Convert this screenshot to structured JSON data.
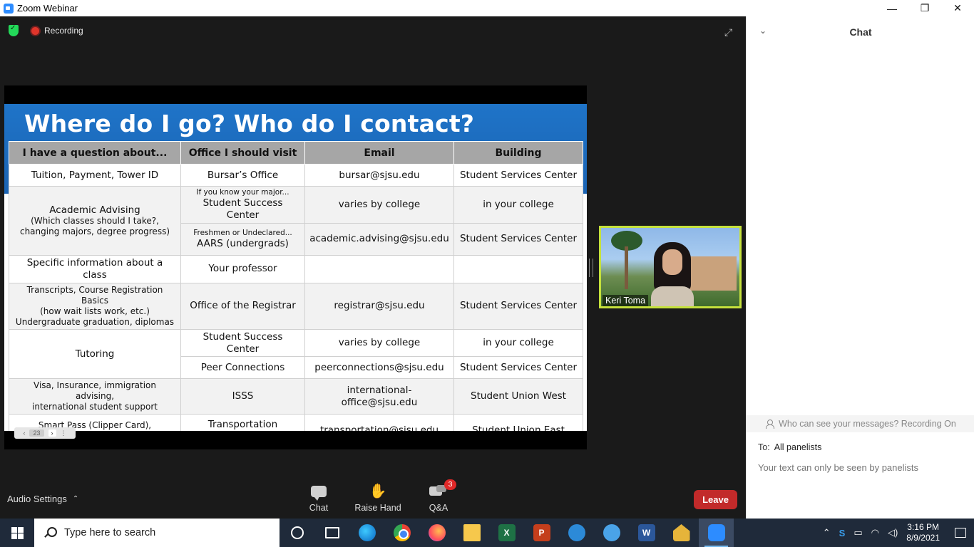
{
  "window": {
    "title": "Zoom Webinar",
    "controls": [
      "—",
      "❐",
      "✕"
    ]
  },
  "status": {
    "recording_label": "Recording"
  },
  "slide": {
    "title": "Where do I go? Who do I contact?",
    "headers": [
      "I have a question about...",
      "Office I should visit",
      "Email",
      "Building"
    ],
    "rows": {
      "tuition": {
        "q": "Tuition, Payment, Tower ID",
        "office": "Bursar’s Office",
        "email": "bursar@sjsu.edu",
        "building": "Student Services Center"
      },
      "advising": {
        "q_title": "Academic Advising",
        "q_sub": "(Which classes should I take?, changing majors, degree progress)",
        "a": {
          "hint": "If you know your major...",
          "office": "Student Success Center",
          "email": "varies by college",
          "building": "in your college"
        },
        "b": {
          "hint": "Freshmen or Undeclared...",
          "office": "AARS (undergrads)",
          "email": "academic.advising@sjsu.edu",
          "building": "Student Services Center"
        }
      },
      "class_info": {
        "q": "Specific information about a class",
        "office": "Your professor",
        "email": "",
        "building": ""
      },
      "registrar": {
        "q1": "Transcripts, Course Registration Basics",
        "q2": "(how wait lists work, etc.)",
        "q3": "Undergraduate graduation, diplomas",
        "office": "Office of the Registrar",
        "email": "registrar@sjsu.edu",
        "building": "Student Services Center"
      },
      "tutoring": {
        "q": "Tutoring",
        "a": {
          "office": "Student Success Center",
          "email": "varies by college",
          "building": "in your college"
        },
        "b": {
          "office": "Peer Connections",
          "email": "peerconnections@sjsu.edu",
          "building": "Student Services Center"
        }
      },
      "intl": {
        "q1": "Visa, Insurance, immigration advising,",
        "q2": "international student support",
        "office": "ISSS",
        "email": "international-office@sjsu.edu",
        "building": "Student Union West"
      },
      "transport": {
        "q": "Smart Pass (Clipper Card), Transportation",
        "office": "Transportation Solutions",
        "email": "transportation@sjsu.edu",
        "building": "Student Union East"
      }
    },
    "nav": {
      "prev": "‹",
      "page": "23",
      "next": "›",
      "more": "⋮"
    }
  },
  "speaker": {
    "name": "Keri Toma"
  },
  "toolbar": {
    "audio_settings": "Audio Settings",
    "chat": "Chat",
    "raise_hand": "Raise Hand",
    "qa": "Q&A",
    "qa_badge": "3",
    "leave": "Leave"
  },
  "chat": {
    "title": "Chat",
    "who_can_see": "Who can see your messages? Recording On",
    "to_label": "To:",
    "to_value": "All panelists",
    "input_placeholder": "Your text can only be seen by panelists"
  },
  "taskbar": {
    "search_placeholder": "Type here to search",
    "time": "3:16 PM",
    "date": "8/9/2021"
  }
}
